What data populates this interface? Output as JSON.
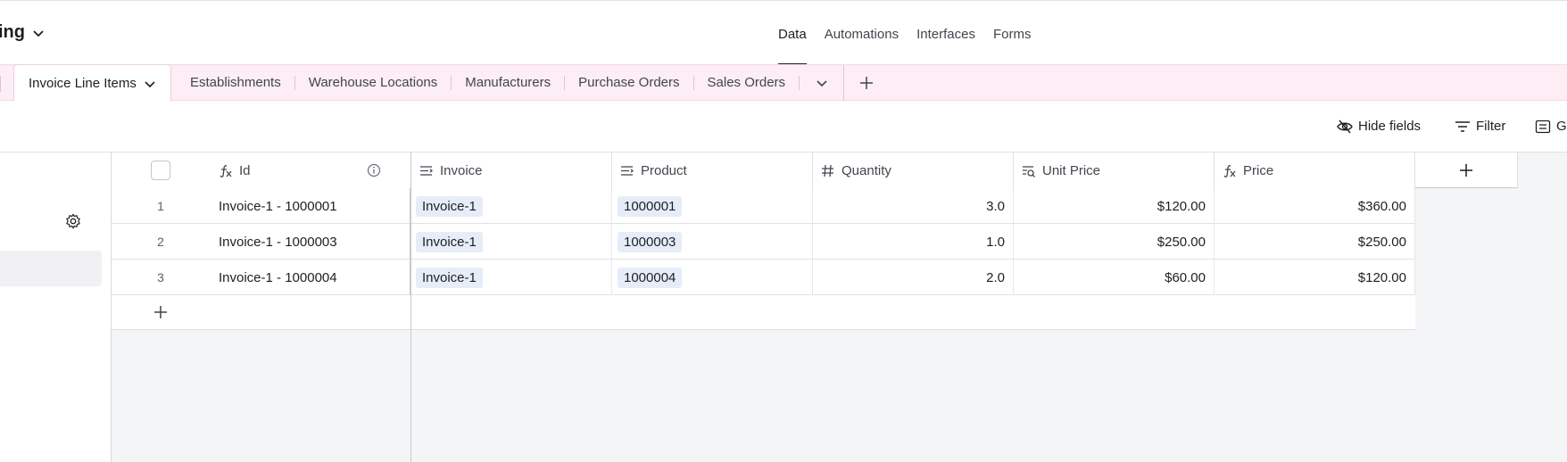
{
  "app": {
    "base_name": "ing"
  },
  "top_nav": [
    "Data",
    "Automations",
    "Interfaces",
    "Forms"
  ],
  "tabs": {
    "active": "Invoice Line Items",
    "items": [
      "Establishments",
      "Warehouse Locations",
      "Manufacturers",
      "Purchase Orders",
      "Sales Orders"
    ]
  },
  "viewbar": {
    "hide_fields": "Hide fields",
    "filter": "Filter",
    "group": "G"
  },
  "table": {
    "columns": [
      {
        "label": "Id",
        "icon": "formula-icon"
      },
      {
        "label": "Invoice",
        "icon": "link-field-icon"
      },
      {
        "label": "Product",
        "icon": "link-field-icon"
      },
      {
        "label": "Quantity",
        "icon": "number-icon"
      },
      {
        "label": "Unit Price",
        "icon": "lookup-icon"
      },
      {
        "label": "Price",
        "icon": "formula-icon"
      }
    ],
    "rows": [
      {
        "num": "1",
        "id": "Invoice-1 - 1000001",
        "invoice": "Invoice-1",
        "product": "1000001",
        "quantity": "3.0",
        "unit_price": "$120.00",
        "price": "$360.00"
      },
      {
        "num": "2",
        "id": "Invoice-1 - 1000003",
        "invoice": "Invoice-1",
        "product": "1000003",
        "quantity": "1.0",
        "unit_price": "$250.00",
        "price": "$250.00"
      },
      {
        "num": "3",
        "id": "Invoice-1 - 1000004",
        "invoice": "Invoice-1",
        "product": "1000004",
        "quantity": "2.0",
        "unit_price": "$60.00",
        "price": "$120.00"
      }
    ]
  },
  "colors": {
    "tabbar_bg": "#fdeef6",
    "chip_bg": "#e6edf8",
    "grid_bg": "#f4f5f7"
  }
}
